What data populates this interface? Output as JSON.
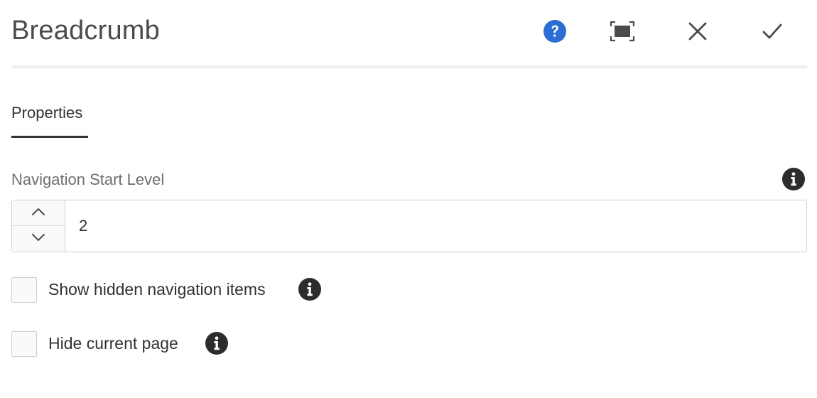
{
  "dialog": {
    "title": "Breadcrumb",
    "actions": {
      "help_icon": "help-icon",
      "fullscreen_icon": "fullscreen-icon",
      "close_icon": "close-icon",
      "done_icon": "checkmark-icon"
    },
    "accent_color": "#2c6ed4"
  },
  "tabs": [
    {
      "label": "Properties",
      "selected": true
    }
  ],
  "form": {
    "navigation_start_level": {
      "label": "Navigation Start Level",
      "value": "2",
      "increment_icon": "chevron-up-icon",
      "decrement_icon": "chevron-down-icon"
    },
    "show_hidden": {
      "label": "Show hidden navigation items",
      "checked": false
    },
    "hide_current": {
      "label": "Hide current page",
      "checked": false
    }
  }
}
